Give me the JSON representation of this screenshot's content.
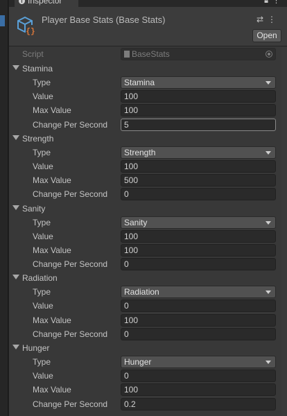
{
  "window": {
    "tab_label": "Inspector",
    "title": "Player Base Stats (Base Stats)",
    "open_label": "Open"
  },
  "script_field": {
    "label": "Script",
    "value": "BaseStats"
  },
  "sections": [
    {
      "title": "Stamina",
      "type": "Stamina",
      "value": "100",
      "max_value": "100",
      "change_per_second": "5"
    },
    {
      "title": "Strength",
      "type": "Strength",
      "value": "100",
      "max_value": "500",
      "change_per_second": "0"
    },
    {
      "title": "Sanity",
      "type": "Sanity",
      "value": "100",
      "max_value": "100",
      "change_per_second": "0"
    },
    {
      "title": "Radiation",
      "type": "Radiation",
      "value": "0",
      "max_value": "100",
      "change_per_second": "0"
    },
    {
      "title": "Hunger",
      "type": "Hunger",
      "value": "0",
      "max_value": "100",
      "change_per_second": "0.2"
    }
  ],
  "field_labels": {
    "type": "Type",
    "value": "Value",
    "max_value": "Max Value",
    "change_per_second": "Change Per Second"
  },
  "icons": [
    "info-icon",
    "lock-icon",
    "more-icon",
    "script-asset-icon",
    "settings-icon",
    "object-picker-icon"
  ]
}
